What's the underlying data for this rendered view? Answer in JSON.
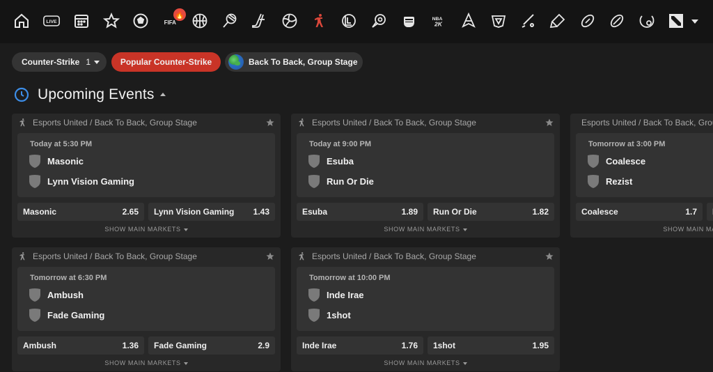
{
  "nav": {
    "icons": [
      {
        "name": "home-icon"
      },
      {
        "name": "live-icon",
        "label": "LIVE"
      },
      {
        "name": "calendar-icon"
      },
      {
        "name": "favorites-star-icon"
      },
      {
        "name": "soccer-icon"
      },
      {
        "name": "fifa-icon",
        "label": "FIFA",
        "badge": "🔥"
      },
      {
        "name": "basketball-icon"
      },
      {
        "name": "tennis-icon"
      },
      {
        "name": "hockey-icon"
      },
      {
        "name": "volleyball-icon"
      },
      {
        "name": "counter-strike-icon",
        "active": true
      },
      {
        "name": "league-of-legends-icon"
      },
      {
        "name": "rocket-league-icon"
      },
      {
        "name": "fist-icon"
      },
      {
        "name": "nba2k-icon",
        "label": "NBA 2K"
      },
      {
        "name": "esports-icon-1"
      },
      {
        "name": "esports-icon-2"
      },
      {
        "name": "cricket-icon"
      },
      {
        "name": "esports-icon-3"
      },
      {
        "name": "american-football-icon"
      },
      {
        "name": "rugby-icon"
      },
      {
        "name": "overwatch-icon"
      },
      {
        "name": "dota-icon"
      }
    ]
  },
  "filters": {
    "game": "Counter-Strike",
    "game_count": "1",
    "popular": "Popular Counter-Strike",
    "league": "Back To Back, Group Stage"
  },
  "section": {
    "title": "Upcoming Events"
  },
  "events": [
    {
      "league": "Esports United / Back To Back, Group Stage",
      "time": "Today at 5:30 PM",
      "team1": "Masonic",
      "team2": "Lynn Vision Gaming",
      "odd1": "2.65",
      "odd2": "1.43",
      "markets": "SHOW MAIN MARKETS"
    },
    {
      "league": "Esports United / Back To Back, Group Stage",
      "time": "Today at 9:00 PM",
      "team1": "Esuba",
      "team2": "Run Or Die",
      "odd1": "1.89",
      "odd2": "1.82",
      "markets": "SHOW MAIN MARKETS"
    },
    {
      "league": "Esports United / Back To Back, Group Stage",
      "time": "Tomorrow at 3:00 PM",
      "team1": "Coalesce",
      "team2": "Rezist",
      "odd1": "1.7",
      "odd2": "",
      "markets": "SHOW MAIN MARKETS"
    },
    {
      "league": "Esports United / Back To Back, Group Stage",
      "time": "Tomorrow at 6:30 PM",
      "team1": "Ambush",
      "team2": "Fade Gaming",
      "odd1": "1.36",
      "odd2": "2.9",
      "markets": "SHOW MAIN MARKETS"
    },
    {
      "league": "Esports United / Back To Back, Group Stage",
      "time": "Tomorrow at 10:00 PM",
      "team1": "Inde Irae",
      "team2": "1shot",
      "odd1": "1.76",
      "odd2": "1.95",
      "markets": "SHOW MAIN MARKETS"
    }
  ],
  "colors": {
    "accent_red": "#c93427",
    "active_icon": "#d9473a",
    "clock_blue": "#3d8ee8"
  }
}
